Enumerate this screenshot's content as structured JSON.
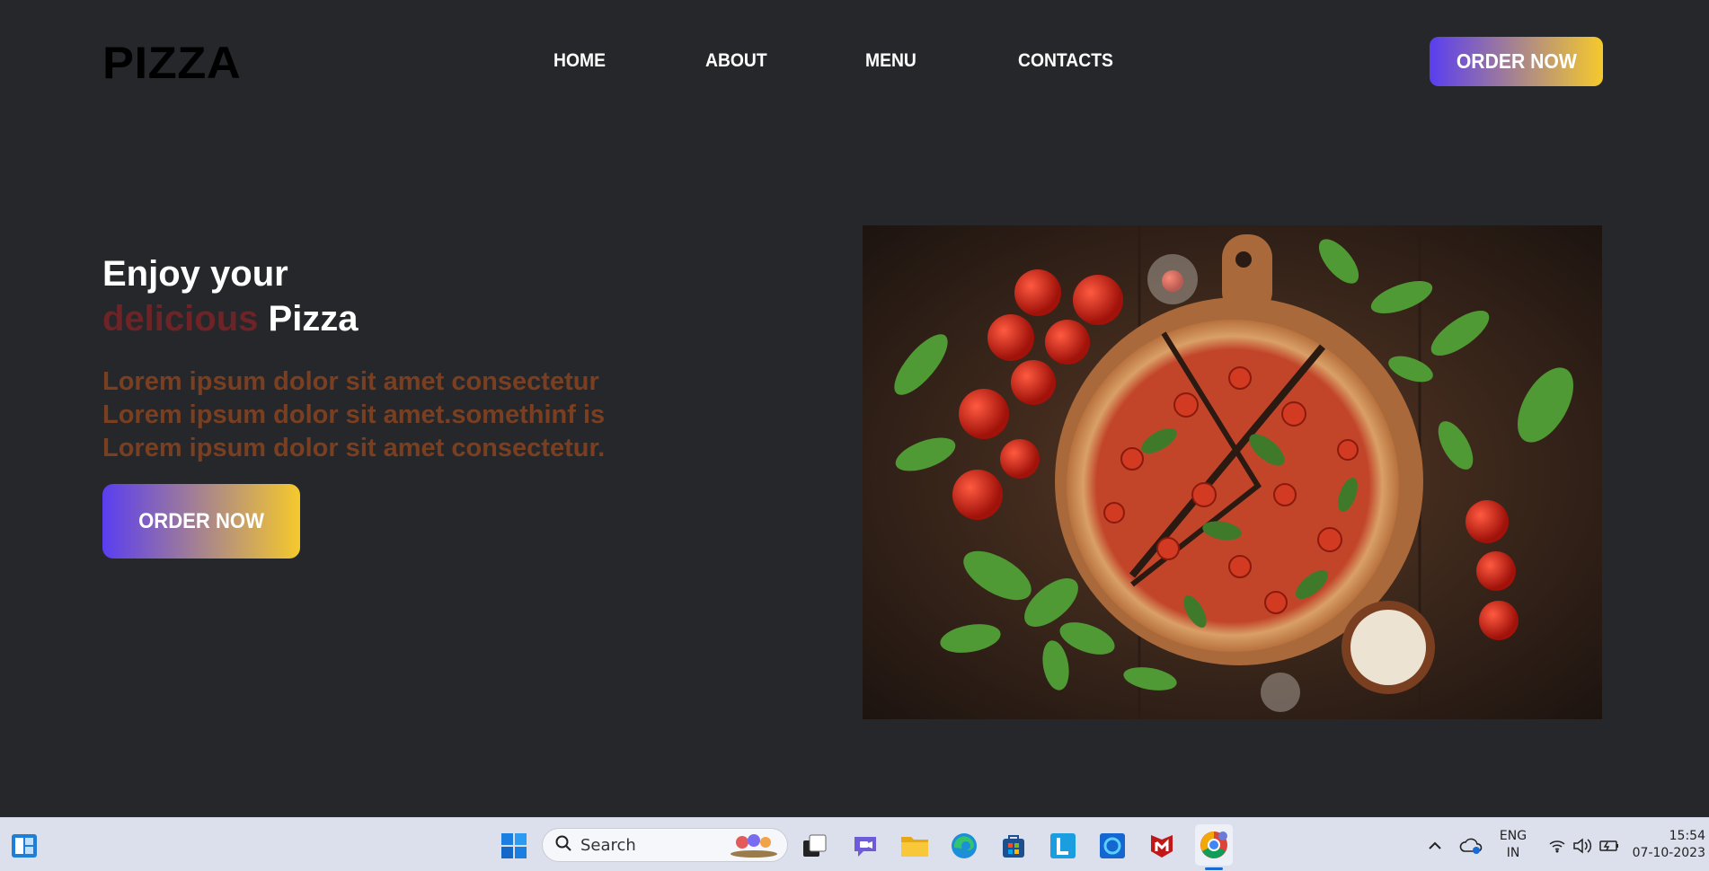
{
  "header": {
    "logo": "PIZZA",
    "nav": [
      "HOME",
      "ABOUT",
      "MENU",
      "CONTACTS"
    ],
    "order_button": "ORDER NOW"
  },
  "hero": {
    "heading_line1": "Enjoy your",
    "heading_highlight": "delicious",
    "heading_rest": "Pizza",
    "paragraph": "Lorem ipsum dolor sit amet consectetur Lorem ipsum dolor sit amet.somethinf is Lorem ipsum dolor sit amet consectetur.",
    "order_button": "ORDER NOW"
  },
  "colors": {
    "background": "#26272b",
    "highlight": "#6e2326",
    "paragraph": "#7a3f20",
    "button_gradient_start": "#5a3ef0",
    "button_gradient_end": "#f5c92c"
  },
  "taskbar": {
    "search_placeholder": "Search",
    "language_line1": "ENG",
    "language_line2": "IN",
    "time": "15:54",
    "date": "07-10-2023",
    "icons": [
      "widgets-icon",
      "windows-start-icon",
      "search-icon",
      "task-view-icon",
      "chat-icon",
      "file-explorer-icon",
      "edge-icon",
      "store-icon",
      "l-app-icon",
      "cortana-icon",
      "mcafee-icon",
      "chrome-icon",
      "chevron-up-icon",
      "onedrive-icon",
      "wifi-icon",
      "volume-icon",
      "battery-icon"
    ]
  }
}
